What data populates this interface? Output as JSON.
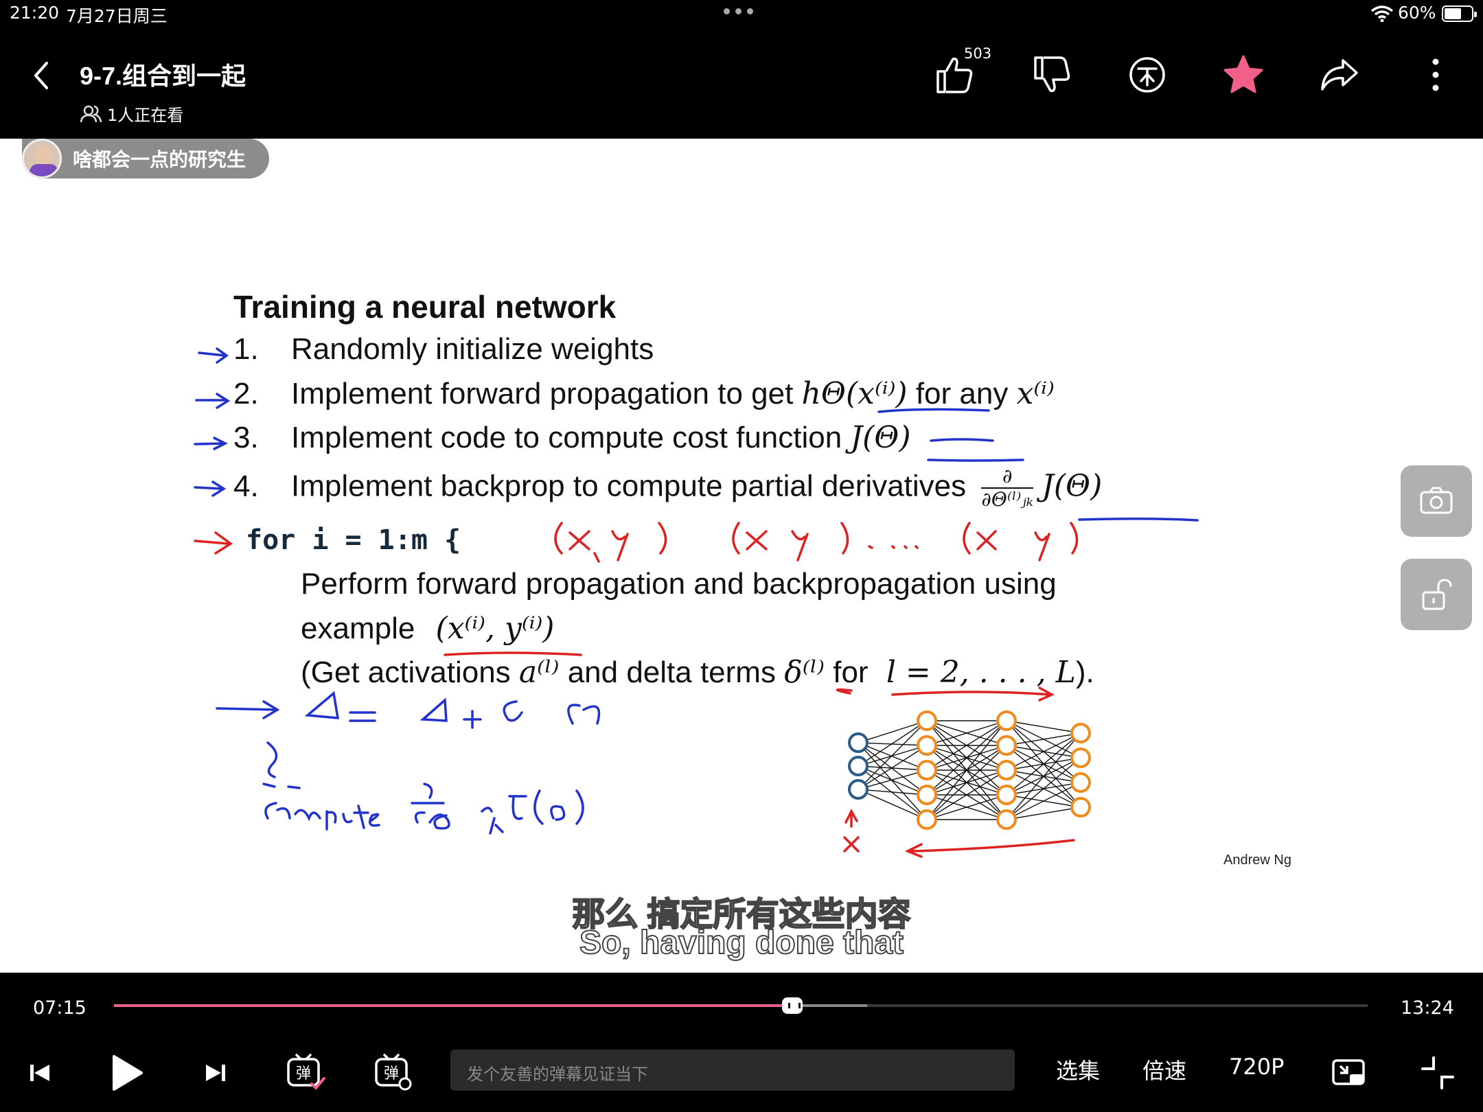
{
  "status_bar": {
    "time": "21:20",
    "date": "7月27日周三",
    "battery": "60%"
  },
  "header": {
    "title": "9-7.组合到一起",
    "viewers": "1人正在看",
    "like_count": "503",
    "favorite_color": "#f2608a"
  },
  "video": {
    "uploader_name": "啥都会一点的研究生",
    "slide": {
      "title": "Training a neural network",
      "step1_num": "1.",
      "step1_text": "Randomly initialize weights",
      "step2_num": "2.",
      "step2_text": "Implement forward propagation to get",
      "step2_math": "hΘ(x⁽ⁱ⁾)",
      "step2_tail": "for any",
      "step2_math2": "x⁽ⁱ⁾",
      "step3_num": "3.",
      "step3_text": "Implement code to compute cost function",
      "step3_math": "J(Θ)",
      "step4_num": "4.",
      "step4_text": "Implement backprop to compute partial derivatives",
      "step4_math_num": "∂",
      "step4_math_den": "∂Θ⁽ˡ⁾ⱼₖ",
      "step4_math_tail": "J(Θ)",
      "for_loop": "for i = 1:m {",
      "perform_line1": "Perform forward propagation and backpropagation using",
      "perform_line2": "example",
      "perform_math": "(x⁽ⁱ⁾, y⁽ⁱ⁾)",
      "get_line_a": "(Get activations",
      "get_math_a": "a⁽ˡ⁾",
      "get_line_b": "and delta terms",
      "get_math_b": "δ⁽ˡ⁾",
      "get_line_c": "for",
      "get_math_c": "l = 2, . . . , L",
      "get_line_d": ").",
      "credit": "Andrew Ng"
    },
    "subtitle_cn": "那么 搞定所有这些内容",
    "subtitle_en": "So, having done that"
  },
  "player": {
    "current_time": "07:15",
    "total_time": "13:24",
    "progress": 0.541,
    "buffered": 0.601,
    "danmaku_placeholder": "发个友善的弹幕见证当下",
    "episodes_label": "选集",
    "speed_label": "倍速",
    "quality_label": "720P",
    "accent_color": "#f2608a"
  }
}
